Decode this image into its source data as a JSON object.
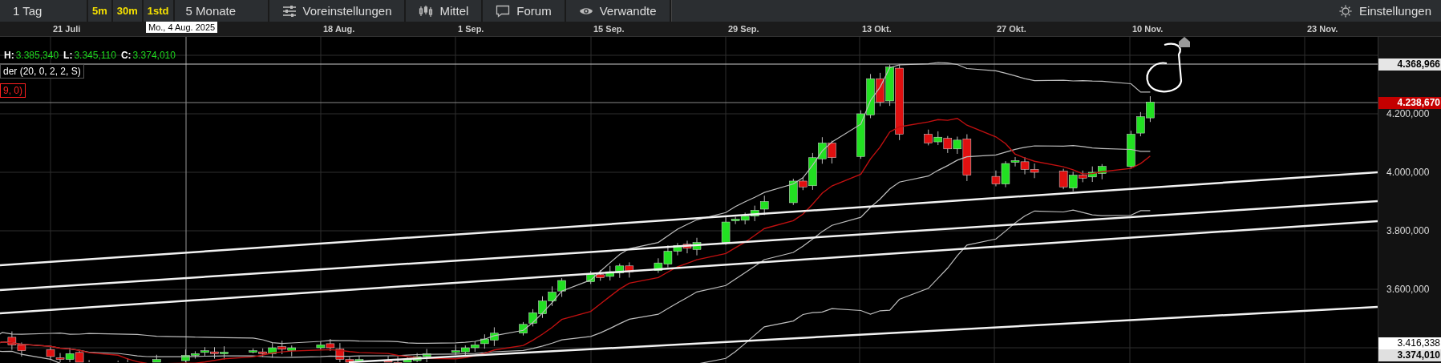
{
  "toolbar": {
    "range": "1 Tag",
    "intervals": [
      "5m",
      "30m",
      "1std"
    ],
    "period": "5 Monate",
    "tools": [
      "Voreinstellungen",
      "Mittel",
      "Forum",
      "Verwandte"
    ],
    "settings": "Einstellungen"
  },
  "time_axis": {
    "labels": [
      "21 Juli",
      "18 Aug.",
      "1 Sep.",
      "15 Sep.",
      "29 Sep.",
      "13 Okt.",
      "27 Okt.",
      "10 Nov.",
      "23 Nov."
    ],
    "cursor_label": "Mo., 4 Aug. 2025"
  },
  "legend": {
    "ohlc": [
      {
        "key": "H:",
        "value": "3.385,340"
      },
      {
        "key": "L:",
        "value": "3.345,110"
      },
      {
        "key": "C:",
        "value": "3.374,010"
      }
    ],
    "indicators": [
      {
        "label": "der (20, 0, 2, 2, S)",
        "color": "#ffffff"
      },
      {
        "label": "9, 0)",
        "color": "#ff2020"
      }
    ]
  },
  "price_axis": {
    "ticks": [
      "4.200,000",
      "4.000,000",
      "3.800,000",
      "3.600,000"
    ],
    "markers": [
      {
        "value": "4.368,966",
        "kind": "line"
      },
      {
        "value": "4.238,670",
        "kind": "last"
      },
      {
        "value": "3.416,338",
        "kind": "cursor"
      },
      {
        "value": "3.374,010",
        "kind": "close"
      }
    ]
  }
}
